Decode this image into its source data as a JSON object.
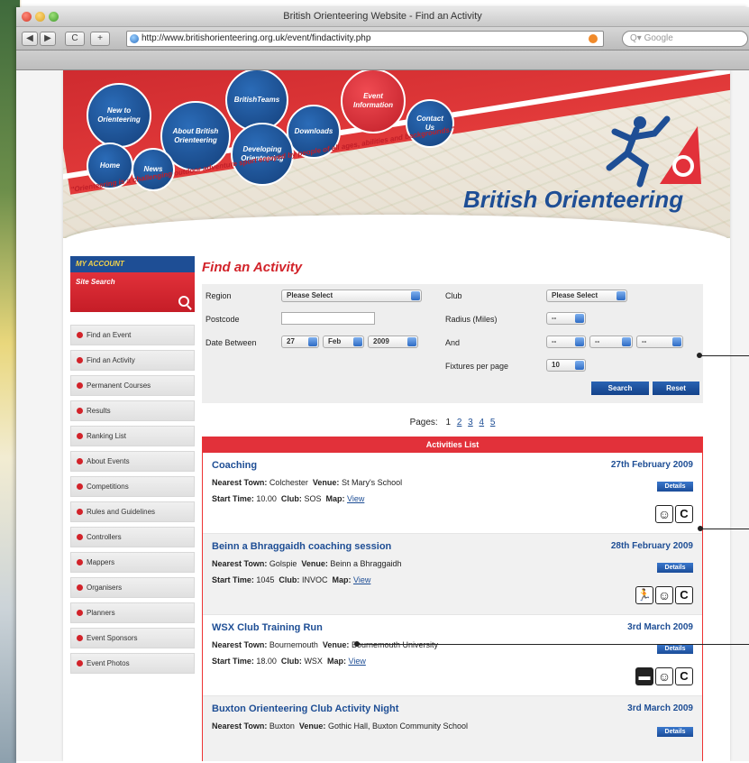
{
  "window": {
    "title": "British Orienteering Website - Find an Activity",
    "url": "http://www.britishorienteering.org.uk/event/findactivity.php",
    "search_placeholder": "Google",
    "back_label": "◀",
    "forward_label": "▶",
    "reload_label": "C",
    "add_label": "+"
  },
  "banner": {
    "bubbles": [
      "New to Orienteering",
      "BritishTeams",
      "Event Information",
      "About British Orienteering",
      "Downloads",
      "Contact Us",
      "Home",
      "News",
      "Developing Orienteering"
    ],
    "tagline_left": "\"Orienteering is a challenging outdoor adventure sport enjoyed by people of all ages, abilities and backgrounds.\"",
    "logo_text": "British Orienteering"
  },
  "sidebar": {
    "my_account": "MY ACCOUNT",
    "site_search": "Site Search",
    "items": [
      "Find an Event",
      "Find an Activity",
      "Permanent Courses",
      "Results",
      "Ranking List",
      "About Events",
      "Competitions",
      "Rules and Guidelines",
      "Controllers",
      "Mappers",
      "Organisers",
      "Planners",
      "Event Sponsors",
      "Event Photos"
    ]
  },
  "main": {
    "heading": "Find an Activity",
    "filters": {
      "region_label": "Region",
      "region_value": "Please Select",
      "club_label": "Club",
      "club_value": "Please Select",
      "postcode_label": "Postcode",
      "radius_label": "Radius (Miles)",
      "radius_value": "--",
      "date_label": "Date Between",
      "date_day": "27",
      "date_month": "Feb",
      "date_year": "2009",
      "and_label": "And",
      "and_day": "--",
      "and_month": "--",
      "and_year": "--",
      "fixtures_label": "Fixtures per page",
      "fixtures_value": "10",
      "search_label": "Search",
      "reset_label": "Reset"
    },
    "pages_label": "Pages:",
    "pages": [
      "1",
      "2",
      "3",
      "4",
      "5"
    ],
    "list_header": "Activities List",
    "activities": [
      {
        "title": "Coaching",
        "date": "27th February 2009",
        "town": "Colchester",
        "venue": "St Mary's School",
        "start": "10.00",
        "club": "SOS",
        "map": "View",
        "icons": [
          "smile",
          "C"
        ]
      },
      {
        "title": "Beinn a Bhraggaidh coaching session",
        "date": "28th February 2009",
        "town": "Golspie",
        "venue": "Beinn a Bhraggaidh",
        "start": "1045",
        "club": "INVOC",
        "map": "View",
        "icons": [
          "runner",
          "smile",
          "C"
        ]
      },
      {
        "title": "WSX Club Training Run",
        "date": "3rd March 2009",
        "town": "Bournemouth",
        "venue": "Bournemouth University",
        "start": "18.00",
        "club": "WSX",
        "map": "View",
        "icons": [
          "torch",
          "smile",
          "C"
        ]
      },
      {
        "title": "Buxton Orienteering Club Activity Night",
        "date": "3rd March 2009",
        "town": "Buxton",
        "venue": "Gothic Hall, Buxton Community School"
      }
    ],
    "labels": {
      "nearest_town": "Nearest Town:",
      "venue": "Venue:",
      "start_time": "Start Time:",
      "club": "Club:",
      "map": "Map:",
      "details": "Details"
    }
  }
}
